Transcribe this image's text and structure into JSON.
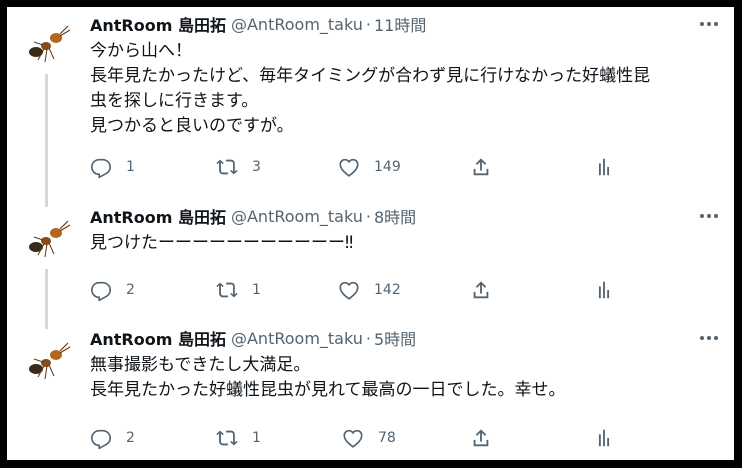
{
  "tweets": [
    {
      "name": "AntRoom 島田拓",
      "handle": "@AntRoom_taku",
      "dot": "·",
      "time": "11時間",
      "lines": [
        "今から山へ！",
        "長年見たかったけど、毎年タイミングが合わず見に行けなかった好蟻性昆",
        "虫を探しに行きます。",
        "見つかると良いのですが。"
      ],
      "reply_count": "1",
      "retweet_count": "3",
      "like_count": "149"
    },
    {
      "name": "AntRoom 島田拓",
      "handle": "@AntRoom_taku",
      "dot": "·",
      "time": "8時間",
      "lines": [
        "見つけたーーーーーーーーーーー‼"
      ],
      "reply_count": "2",
      "retweet_count": "1",
      "like_count": "142"
    },
    {
      "name": "AntRoom 島田拓",
      "handle": "@AntRoom_taku",
      "dot": "·",
      "time": "5時間",
      "lines": [
        "無事撮影もできたし大満足。",
        "長年見たかった好蟻性昆虫が見れて最高の一日でした。幸せ。"
      ],
      "reply_count": "2",
      "retweet_count": "1",
      "like_count": "78"
    }
  ],
  "icons": {
    "avatar": "ant-avatar",
    "more": "more-horizontal-icon",
    "reply": "reply-icon",
    "retweet": "retweet-icon",
    "like": "heart-icon",
    "share": "share-icon",
    "analytics": "analytics-icon"
  },
  "colors": {
    "text": "#0f1419",
    "secondary": "#536471",
    "thread_line": "#cfd9de",
    "frame": "#000000"
  }
}
